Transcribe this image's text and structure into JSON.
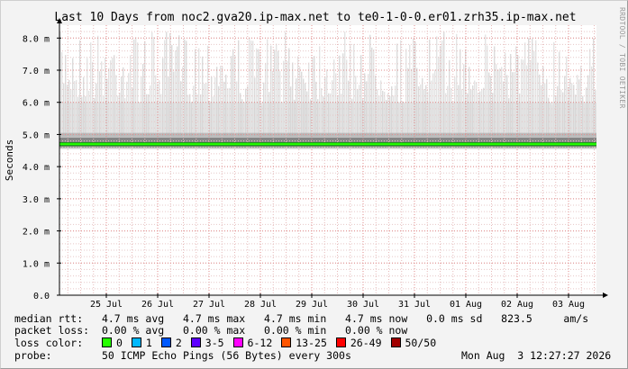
{
  "chart_data": {
    "type": "area",
    "title": "Last 10 Days from noc2.gva20.ip-max.net to te0-1-0-0.er01.zrh35.ip-max.net",
    "ylabel": "Seconds",
    "xlabel": "",
    "ylim": [
      0,
      8.4
    ],
    "ytick_values": [
      0,
      1,
      2,
      3,
      4,
      5,
      6,
      7,
      8
    ],
    "yticks": [
      "0.0",
      "1.0 m",
      "2.0 m",
      "3.0 m",
      "4.0 m",
      "5.0 m",
      "6.0 m",
      "7.0 m",
      "8.0 m"
    ],
    "xticks": [
      "25 Jul",
      "26 Jul",
      "27 Jul",
      "28 Jul",
      "29 Jul",
      "30 Jul",
      "31 Jul",
      "01 Aug",
      "02 Aug",
      "03 Aug"
    ],
    "grid": true,
    "series": [
      {
        "name": "median rtt",
        "values": [
          4.7,
          4.7,
          4.7,
          4.7,
          4.7,
          4.7,
          4.7,
          4.7,
          4.7,
          4.7
        ],
        "color": "#22cc22"
      },
      {
        "name": "ping spread max",
        "values": [
          8.2,
          8.2,
          8.2,
          8.1,
          8.2,
          8.2,
          8.1,
          8.2,
          8.2,
          8.1
        ],
        "color": "#cccccc"
      }
    ]
  },
  "legend": {
    "median_rtt": {
      "label": "median rtt:",
      "avg": "4.7 ms avg",
      "max": "4.7 ms max",
      "min": "4.7 ms min",
      "now": "4.7 ms now",
      "sd": "0.0 ms sd",
      "am": "823.5",
      "am_unit": "am/s"
    },
    "packet_loss": {
      "label": "packet loss:",
      "avg": "0.00 % avg",
      "max": "0.00 % max",
      "min": "0.00 % min",
      "now": "0.00 % now"
    },
    "loss_color": {
      "label": "loss color:",
      "items": [
        {
          "label": "0",
          "color": "#26ff00"
        },
        {
          "label": "1",
          "color": "#00b8ff"
        },
        {
          "label": "2",
          "color": "#0059ff"
        },
        {
          "label": "3-5",
          "color": "#5e00ff"
        },
        {
          "label": "6-12",
          "color": "#ff00ff"
        },
        {
          "label": "13-25",
          "color": "#ff5500"
        },
        {
          "label": "26-49",
          "color": "#ff0000"
        },
        {
          "label": "50/50",
          "color": "#a10000"
        }
      ]
    },
    "probe": {
      "label": "probe:",
      "text": "50 ICMP Echo Pings (56 Bytes) every 300s",
      "timestamp": "Mon Aug  3 12:27:27 2026"
    }
  },
  "watermark": "RRDTOOL / TOBI OETIKER"
}
